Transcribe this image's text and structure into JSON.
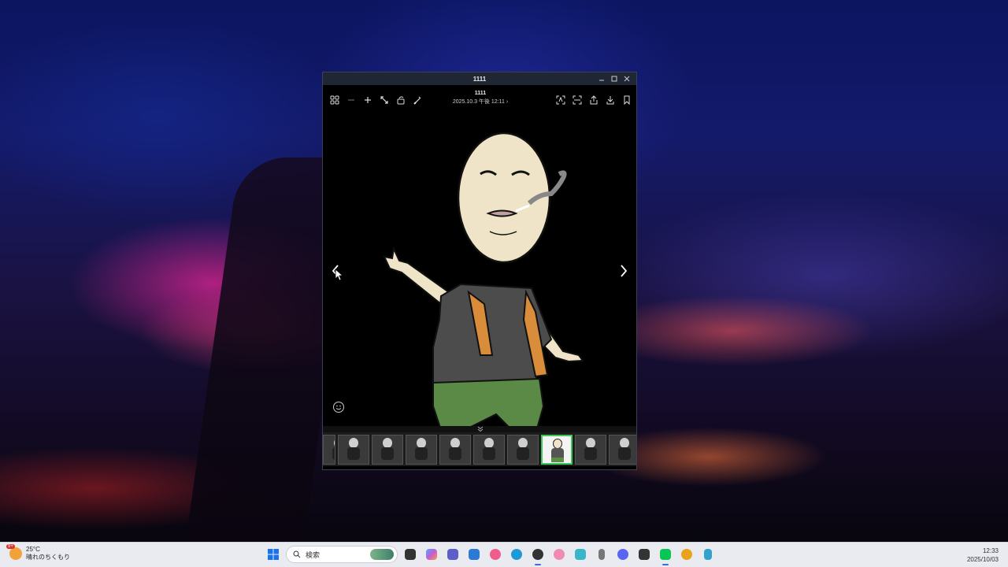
{
  "window": {
    "title": "1111",
    "file_name": "1111",
    "file_date": "2025.10.3 午後 12:11",
    "date_chevron": "›"
  },
  "toolbar": {
    "left_icons": [
      "grid-icon",
      "zoom-out-icon",
      "zoom-in-icon",
      "fit-expand-icon",
      "rotate-icon",
      "edit-brush-icon"
    ],
    "right_icons": [
      "text-recognition-icon",
      "scan-icon",
      "share-icon",
      "download-icon",
      "bookmark-icon"
    ]
  },
  "filmstrip": {
    "thumbnail_count": 10,
    "selected_index": 7
  },
  "taskbar": {
    "weather": {
      "badge": "9+",
      "temperature": "25°C",
      "condition": "晴れのちくもり"
    },
    "search": {
      "placeholder": "検索"
    },
    "apps": [
      {
        "name": "file-explorer-icon",
        "color": "#333333"
      },
      {
        "name": "copilot-icon",
        "color": "#c65bd9"
      },
      {
        "name": "teams-icon",
        "color": "#5b5fc7"
      },
      {
        "name": "microsoft-store-icon",
        "color": "#2b7bd6"
      },
      {
        "name": "itunes-icon",
        "color": "#f05d8a"
      },
      {
        "name": "edge-icon",
        "color": "#1f9ad6"
      },
      {
        "name": "obs-icon",
        "color": "#333333"
      },
      {
        "name": "pink-app-icon",
        "color": "#f28ab3"
      },
      {
        "name": "globe-app-icon",
        "color": "#3bb6c9"
      },
      {
        "name": "phone-app-icon",
        "color": "#777777"
      },
      {
        "name": "discord-icon",
        "color": "#5865f2"
      },
      {
        "name": "nev-app-icon",
        "color": "#333333"
      },
      {
        "name": "line-icon",
        "color": "#06c755"
      },
      {
        "name": "coin-app-icon",
        "color": "#e8a21c"
      },
      {
        "name": "notepad-icon",
        "color": "#2fa3c9"
      }
    ],
    "clock": {
      "time": "12:33",
      "date": "2025/10/03"
    }
  }
}
